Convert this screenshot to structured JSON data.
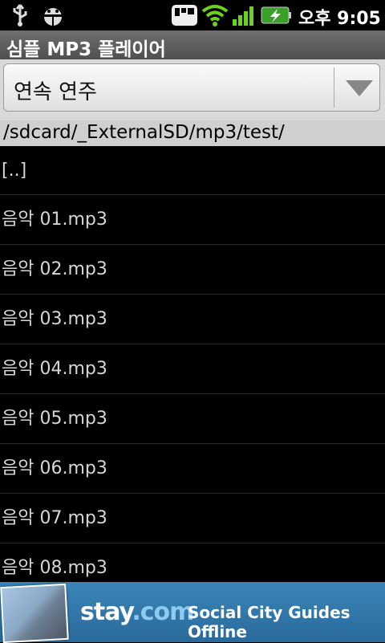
{
  "status_bar": {
    "time": "오후 9:05",
    "icons": [
      "usb-icon",
      "debug-icon",
      "notification-icon",
      "wifi-icon",
      "signal-icon",
      "battery-charging-icon"
    ]
  },
  "title": "심플 MP3 플레이어",
  "spinner": {
    "selected": "연속 연주"
  },
  "path": "/sdcard/_ExternalSD/mp3/test/",
  "files": [
    "[..]",
    "음악 01.mp3",
    "음악 02.mp3",
    "음악 03.mp3",
    "음악 04.mp3",
    "음악 05.mp3",
    "음악 06.mp3",
    "음악 07.mp3",
    "음악 08.mp3"
  ],
  "ad": {
    "logo_main": "stay",
    "logo_suffix": ".com",
    "tagline": "Social City Guides Offline"
  }
}
